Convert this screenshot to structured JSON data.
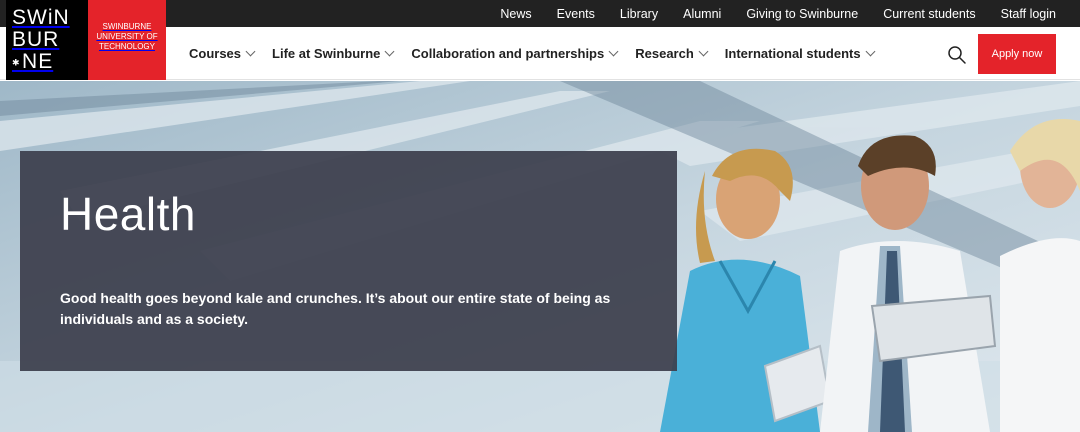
{
  "topbar": {
    "links": [
      "News",
      "Events",
      "Library",
      "Alumni",
      "Giving to Swinburne",
      "Current students",
      "Staff login"
    ]
  },
  "logo": {
    "line1": "SWiN",
    "line2": "BUR",
    "line3": "NE",
    "institution": "SWINBURNE UNIVERSITY OF TECHNOLOGY"
  },
  "nav": {
    "items": [
      "Courses",
      "Life at Swinburne",
      "Collaboration and partnerships",
      "Research",
      "International students"
    ],
    "apply_label": "Apply now",
    "search_icon": "search-icon"
  },
  "hero": {
    "title": "Health",
    "text": "Good health goes beyond kale and crunches. It’s about our entire state of being as individuals and as a society."
  },
  "colors": {
    "brand_red": "#e4232a",
    "topbar": "#222222",
    "panel": "#3c3e4c"
  }
}
